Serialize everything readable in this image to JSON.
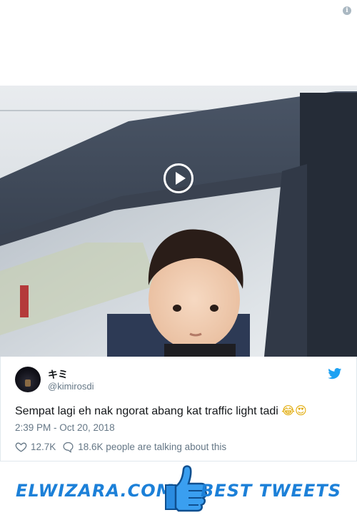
{
  "tweet": {
    "display_name": "キミ",
    "handle": "@kimirosdi",
    "text": "Sempat lagi eh nak ngorat abang kat traffic light tadi",
    "emojis": "😂😍",
    "timestamp": "2:39 PM - Oct 20, 2018",
    "likes": "12.7K",
    "talking": "18.6K people are talking about this"
  },
  "icons": {
    "info": "info-icon",
    "play": "play-icon",
    "twitter": "twitter-bird-icon",
    "heart": "heart-icon",
    "comment": "comment-bubble-icon",
    "thumb": "thumbs-up-icon"
  },
  "banner": {
    "left": "ELWIZARA.COM",
    "right": "BEST TWEETS"
  },
  "colors": {
    "twitter_blue": "#1da1f2",
    "brand_blue": "#1c80d8",
    "meta_gray": "#657786"
  }
}
